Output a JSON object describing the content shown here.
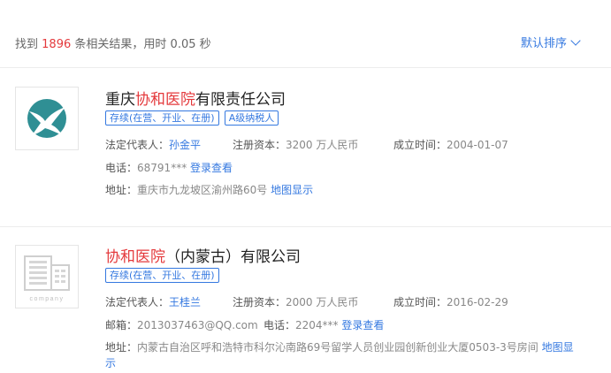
{
  "summary": {
    "prefix": "找到",
    "count": "1896",
    "middle": "条相关结果，用时",
    "time": "0.05",
    "unit": "秒"
  },
  "sort": {
    "label": "默认排序"
  },
  "results": [
    {
      "title_pre": "重庆",
      "title_hl": "协和医院",
      "title_post": "有限责任公司",
      "tags": [
        "存续(在营、开业、在册)",
        "A级纳税人"
      ],
      "legal_rep_label": "法定代表人：",
      "legal_rep": "孙金平",
      "capital_label": "注册资本：",
      "capital": "3200 万人民币",
      "founded_label": "成立时间：",
      "founded": "2004-01-07",
      "phone_label": "电话：",
      "phone": "68791***",
      "login_link": "登录查看",
      "address_label": "地址：",
      "address": "重庆市九龙坡区渝州路60号",
      "map_link": "地图显示"
    },
    {
      "title_pre": "",
      "title_hl": "协和医院",
      "title_post": "（内蒙古）有限公司",
      "tags": [
        "存续(在营、开业、在册)"
      ],
      "logo_text": "company",
      "legal_rep_label": "法定代表人：",
      "legal_rep": "王桂兰",
      "capital_label": "注册资本：",
      "capital": "2000 万人民币",
      "founded_label": "成立时间：",
      "founded": "2016-02-29",
      "email_label": "邮箱：",
      "email": "2013037463@QQ.com",
      "phone_label": "电话：",
      "phone": "2204***",
      "login_link": "登录查看",
      "address_label": "地址：",
      "address": "内蒙古自治区呼和浩特市科尔沁南路69号留学人员创业园创新创业大厦0503-3号房间",
      "map_link": "地图显示"
    }
  ],
  "colors": {
    "accent": "#3478e0",
    "highlight": "#e4393c",
    "logo_teal": "#2f8f94"
  },
  "icons": {
    "logo1": "white-bird-on-teal-circle-logo",
    "logo2": "grey-building-placeholder-icon",
    "sort": "chevron-down-icon"
  }
}
